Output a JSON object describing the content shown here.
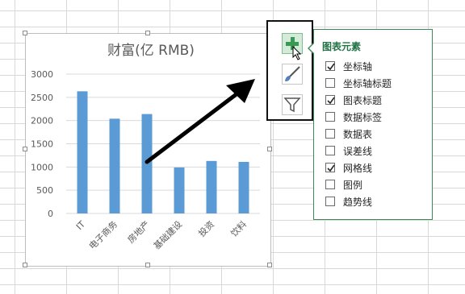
{
  "chart_data": {
    "type": "bar",
    "title": "财富(亿 RMB)",
    "categories": [
      "IT",
      "电子商务",
      "房地产",
      "基础建设",
      "投资",
      "饮料"
    ],
    "values": [
      2630,
      2040,
      2140,
      990,
      1130,
      1110
    ],
    "ylim": [
      0,
      3000
    ],
    "yticks": [
      0,
      500,
      1000,
      1500,
      2000,
      2500,
      3000
    ],
    "grid": true,
    "bar_color": "#5b9bd5"
  },
  "side_buttons": [
    {
      "name": "chart-elements-button",
      "icon": "plus-icon"
    },
    {
      "name": "chart-styles-button",
      "icon": "paintbrush-icon"
    },
    {
      "name": "chart-filters-button",
      "icon": "funnel-icon"
    }
  ],
  "panel": {
    "title": "图表元素",
    "accent": "#217346",
    "items": [
      {
        "label": "坐标轴",
        "checked": true
      },
      {
        "label": "坐标轴标题",
        "checked": false
      },
      {
        "label": "图表标题",
        "checked": true
      },
      {
        "label": "数据标签",
        "checked": false
      },
      {
        "label": "数据表",
        "checked": false
      },
      {
        "label": "误差线",
        "checked": false
      },
      {
        "label": "网格线",
        "checked": true
      },
      {
        "label": "图例",
        "checked": false
      },
      {
        "label": "趋势线",
        "checked": false
      }
    ]
  }
}
